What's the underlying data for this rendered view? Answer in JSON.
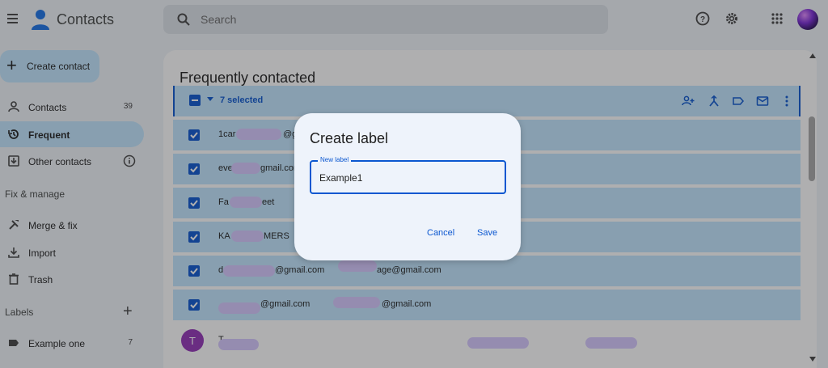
{
  "app": {
    "title": "Contacts"
  },
  "search": {
    "placeholder": "Search"
  },
  "sidebar": {
    "create_label": "Create contact",
    "items": [
      {
        "label": "Contacts",
        "count": "39"
      },
      {
        "label": "Frequent"
      },
      {
        "label": "Other contacts"
      }
    ],
    "fix_manage_heading": "Fix & manage",
    "fix_items": [
      {
        "label": "Merge & fix"
      },
      {
        "label": "Import"
      },
      {
        "label": "Trash"
      }
    ],
    "labels_heading": "Labels",
    "labels": [
      {
        "label": "Example one",
        "count": "7"
      }
    ]
  },
  "main": {
    "title": "Frequently contacted",
    "selection_text": "7 selected",
    "rows": [
      {
        "name": "1car",
        "name_tail": "@g",
        "email2": ""
      },
      {
        "name": "eve",
        "name_tail": "gmail.com",
        "email2": ""
      },
      {
        "name": "Fa",
        "name_tail": "eet",
        "email2": ""
      },
      {
        "name": "KA",
        "name_tail": "MERS",
        "email2": ""
      },
      {
        "name": "d",
        "name_tail": "@gmail.com",
        "email2": "age@gmail.com"
      },
      {
        "name": "",
        "name_tail": "@gmail.com",
        "email2": "@gmail.com"
      }
    ],
    "last_row": {
      "avatar_letter": "T",
      "name": "T"
    }
  },
  "dialog": {
    "title": "Create label",
    "field_label": "New label",
    "field_value": "Example1",
    "cancel_label": "Cancel",
    "save_label": "Save"
  },
  "colors": {
    "accent": "#0b57d0",
    "selection": "#c2e7ff",
    "background": "#f0f4f9"
  }
}
